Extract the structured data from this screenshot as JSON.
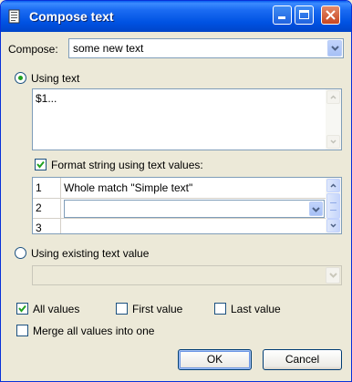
{
  "window": {
    "title": "Compose text"
  },
  "compose": {
    "label": "Compose:",
    "value": "some new text"
  },
  "using_text": {
    "label": "Using text",
    "selected": true,
    "text": "$1..."
  },
  "format": {
    "label": "Format string using text values:",
    "checked": true
  },
  "table_rows": [
    {
      "index": "1",
      "value": "Whole match \"Simple text\""
    },
    {
      "index": "2",
      "value": ""
    },
    {
      "index": "3",
      "value": ""
    }
  ],
  "using_existing": {
    "label": "Using existing text value",
    "selected": false,
    "value": ""
  },
  "options": {
    "all_values": {
      "label": "All values",
      "checked": true
    },
    "first_value": {
      "label": "First value",
      "checked": false
    },
    "last_value": {
      "label": "Last value",
      "checked": false
    },
    "merge": {
      "label": "Merge all values into one",
      "checked": false
    }
  },
  "buttons": {
    "ok": "OK",
    "cancel": "Cancel"
  },
  "colors": {
    "title_bar": "#0054e3",
    "face": "#ece9d8",
    "radio_dot": "#21a121",
    "check": "#21a121"
  }
}
